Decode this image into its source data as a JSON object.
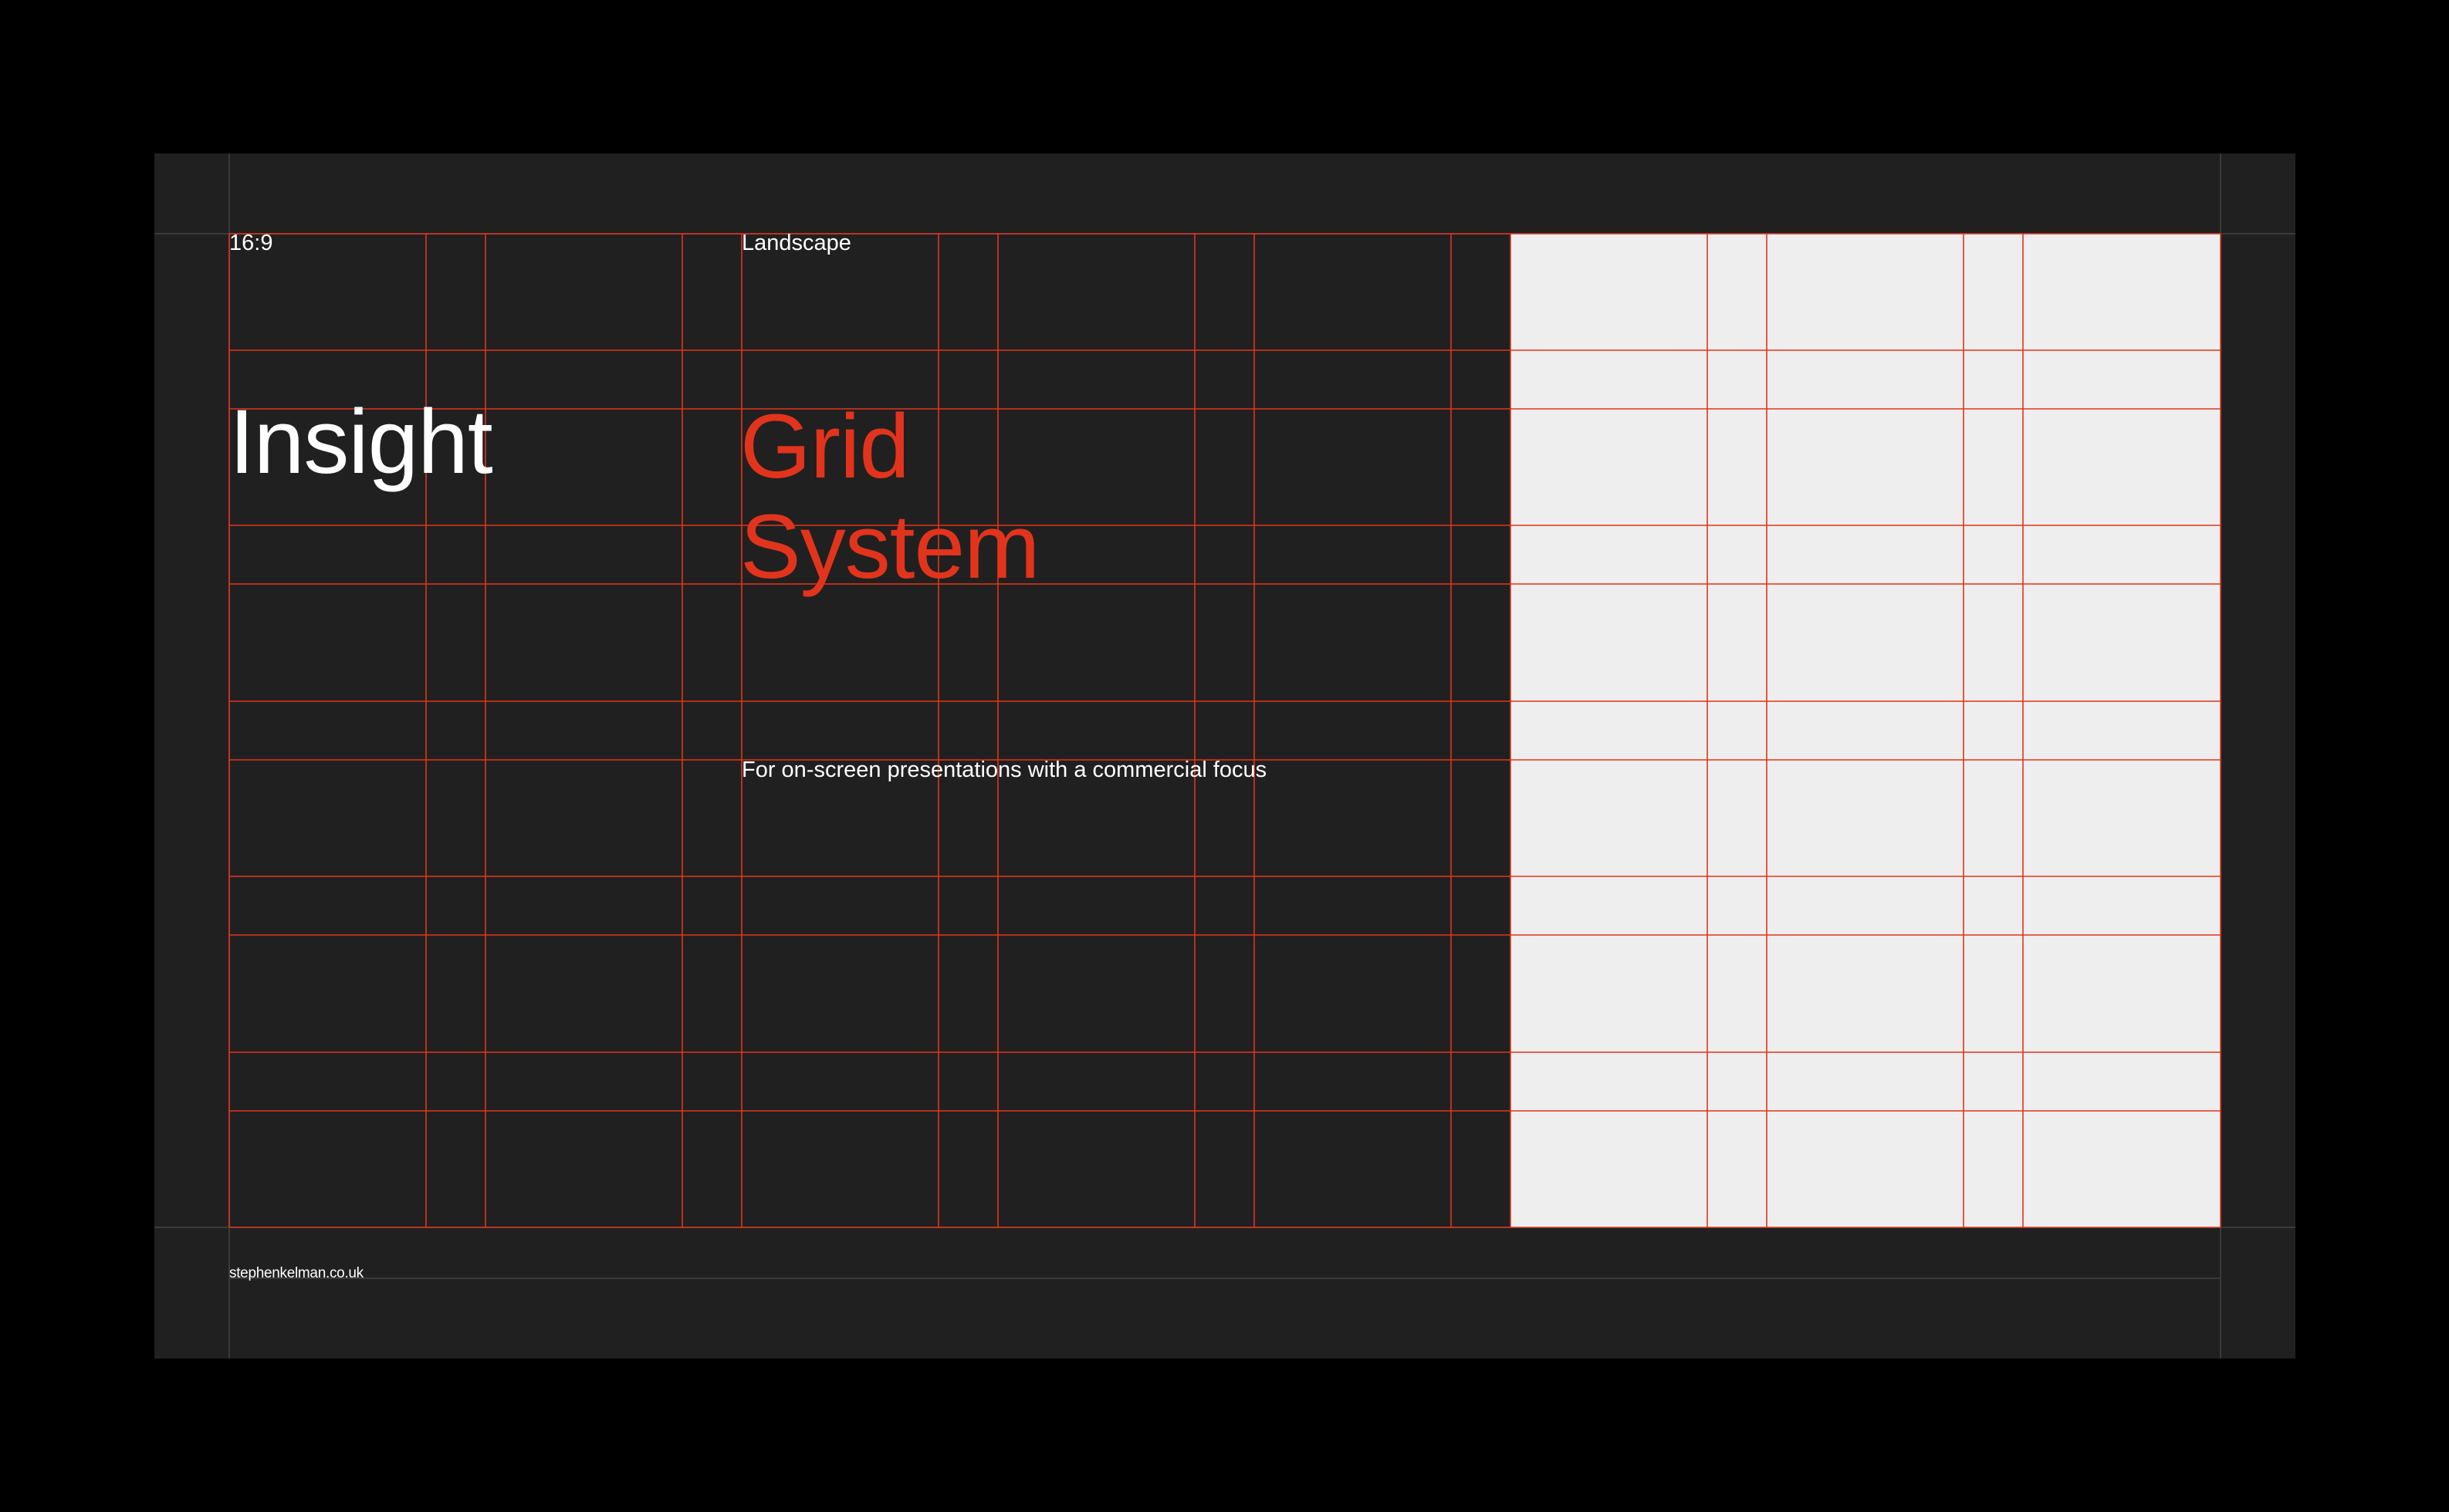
{
  "slide": {
    "ratio": "16:9",
    "orientation": "Landscape",
    "brand": "Insight",
    "title_line1": "Grid",
    "title_line2": "System",
    "subtitle": "For on-screen presentations with a commercial focus",
    "site": "stephenkelman.co.uk"
  },
  "colors": {
    "page_background": "#000000",
    "slide_background": "#202020",
    "light_panel": "#eeeeee",
    "accent_red": "#e2341c",
    "text_white": "#ffffff",
    "guide_gray": "#3a3a3a"
  }
}
